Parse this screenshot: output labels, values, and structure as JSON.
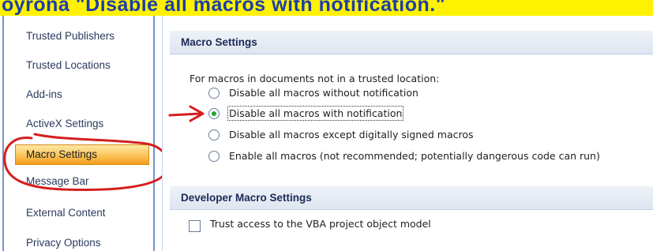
{
  "banner": {
    "text": "oyronà \"Disable all macros with notification.\""
  },
  "sidebar": {
    "items": [
      {
        "label": "Trusted Publishers"
      },
      {
        "label": "Trusted Locations"
      },
      {
        "label": "Add-ins"
      },
      {
        "label": "ActiveX Settings"
      },
      {
        "label": "Macro Settings",
        "selected": true
      },
      {
        "label": "Message Bar"
      },
      {
        "label": "External Content"
      },
      {
        "label": "Privacy Options"
      }
    ]
  },
  "macro_settings": {
    "header": "Macro Settings",
    "prompt": "For macros in documents not in a trusted location:",
    "options": [
      {
        "label": "Disable all macros without notification",
        "checked": false
      },
      {
        "label": "Disable all macros with notification",
        "checked": true
      },
      {
        "label": "Disable all macros except digitally signed macros",
        "checked": false
      },
      {
        "label": "Enable all macros (not recommended; potentially dangerous code can run)",
        "checked": false
      }
    ]
  },
  "developer": {
    "header": "Developer Macro Settings",
    "checkbox_label": "Trust access to the VBA project object model",
    "checked": false
  },
  "colors": {
    "banner": "#fef200",
    "banner_text": "#1c3ea8",
    "selection": "#fbc35a",
    "annotation": "#d41f1f"
  }
}
